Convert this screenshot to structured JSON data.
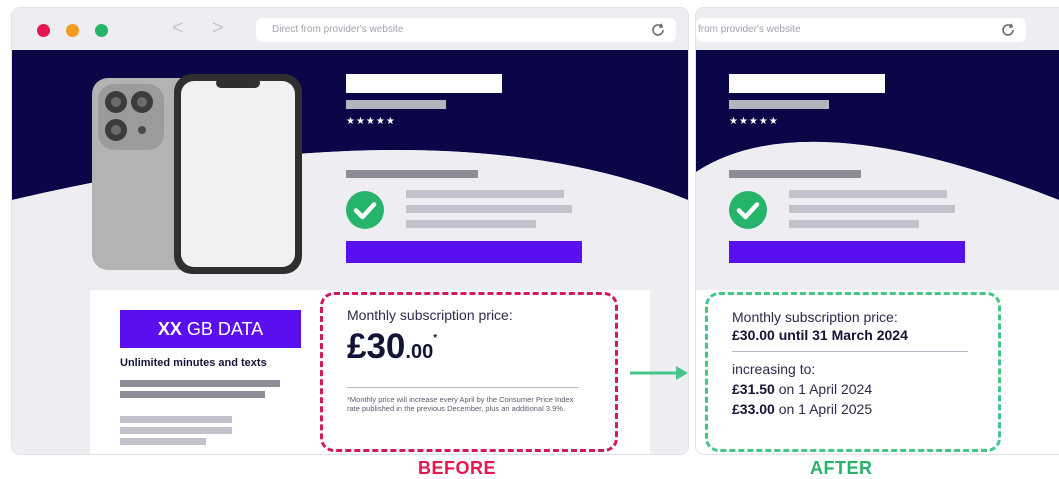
{
  "before_window": {
    "url": "Direct from provider's website",
    "product": {
      "stars": "★★★★★",
      "data_badge_amount": "XX",
      "data_badge_unit": "GB DATA",
      "plan_features": "Unlimited minutes and texts"
    },
    "price_box": {
      "label": "Monthly subscription price:",
      "price_main": "£30",
      "price_pence": ".00",
      "price_marker": "*",
      "footnote": "*Monthly price will increase every April by the Consumer Price Index rate published in the previous December, plus an additional 3.9%."
    }
  },
  "after_window": {
    "url": "from provider's website",
    "stars": "★★★★★",
    "price_box": {
      "label": "Monthly subscription price:",
      "current_price": "£30.00 until 31 March 2024",
      "increase_label": "increasing to:",
      "step1_price": "£31.50",
      "step1_date": " on 1 April 2024",
      "step2_price": "£33.00",
      "step2_date": " on 1 April 2025"
    }
  },
  "captions": {
    "before": "BEFORE",
    "after": "AFTER"
  },
  "colors": {
    "navy": "#0a0648",
    "purple": "#5a10ee",
    "before_accent": "#e4174f",
    "after_accent": "#26b36a"
  }
}
